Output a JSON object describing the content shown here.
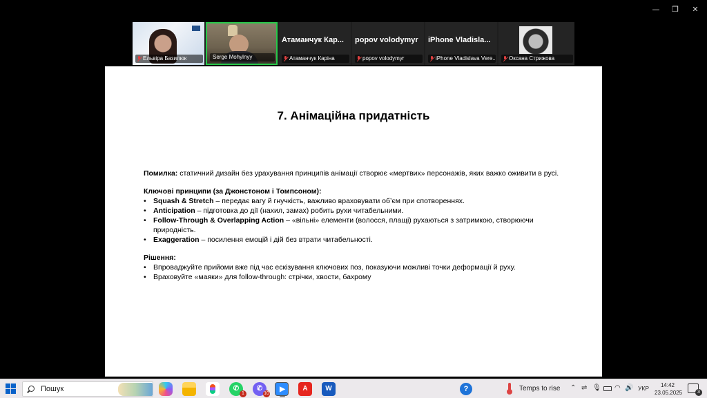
{
  "participants": [
    {
      "label": "Ельвіра Базилюк",
      "big_name": ""
    },
    {
      "label": "Serge Mohylnyy",
      "big_name": ""
    },
    {
      "label": "Атаманчук Каріна",
      "big_name": "Атаманчук Кар..."
    },
    {
      "label": "popov volodymyr",
      "big_name": "popov volodymyr"
    },
    {
      "label": "iPhone Vladislava Vere...",
      "big_name": "iPhone Vladisla..."
    },
    {
      "label": "Оксана Стрижова",
      "big_name": ""
    }
  ],
  "slide": {
    "title": "7. Анімаційна придатність",
    "error_label": "Помилка:",
    "error_text": " статичний дизайн без урахування принципів анімації створює «мертвих» персонажів, яких важко оживити в русі.",
    "principles_heading": "Ключові принципи (за Джонстоном і Томпсоном):",
    "principles": [
      {
        "term": "Squash & Stretch",
        "text": " – передає вагу й гнучкість, важливо враховувати об’єм при спотвореннях."
      },
      {
        "term": "Anticipation",
        "text": " – підготовка до дії (нахил, замах) робить рухи читабельними."
      },
      {
        "term": "Follow-Through & Overlapping Action",
        "text": " – «вільні» елементи (волосся, плащі) рухаються з затримкою, створюючи природність."
      },
      {
        "term": "Exaggeration",
        "text": " – посилення емоцій і дій без втрати читабельності."
      }
    ],
    "solution_heading": "Рішення:",
    "solutions": [
      "Впроваджуйте прийоми вже під час ескізування ключових поз, показуючи можливі точки деформації й руху.",
      "Враховуйте «маяки» для follow-through: стрічки, хвости, бахрому"
    ]
  },
  "window_controls": {
    "minimize": "—",
    "maximize": "❐",
    "close": "✕"
  },
  "taskbar": {
    "search_placeholder": "Пошук",
    "whatsapp_badge": "1",
    "viber_badge": "10",
    "weather": "Temps to rise",
    "language": "УКР",
    "time": "14:42",
    "date": "23.05.2025",
    "notifications": "3"
  }
}
